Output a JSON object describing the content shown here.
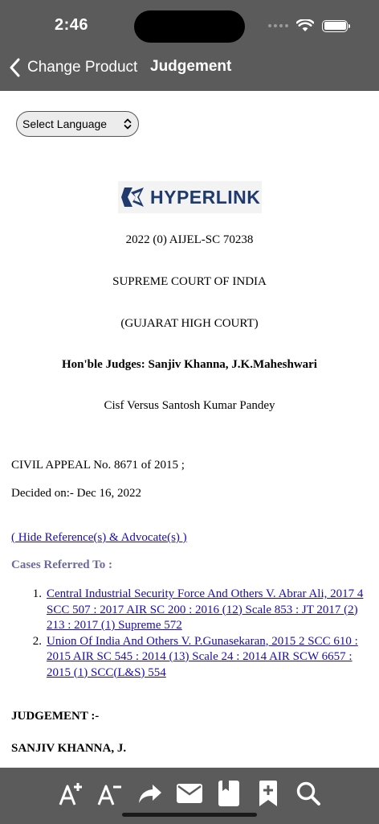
{
  "status_bar": {
    "time": "2:46"
  },
  "nav": {
    "back_label": "Change Product",
    "title": "Judgement"
  },
  "language_select": {
    "label": "Select Language"
  },
  "logo": {
    "text": "HYPERLINK"
  },
  "document": {
    "citation": "2022 (0) AIJEL-SC 70238",
    "court": "SUPREME COURT OF INDIA",
    "lower_court": "(GUJARAT HIGH COURT)",
    "judges": "Hon'ble Judges: Sanjiv Khanna, J.K.Maheshwari",
    "parties": "Cisf Versus Santosh Kumar Pandey",
    "appeal": "CIVIL APPEAL No. 8671 of 2015 ;",
    "decided": "Decided on:- Dec 16, 2022",
    "hide_refs_link": "( Hide Reference(s) & Advocate(s) )",
    "cases_heading": "Cases Referred To :",
    "cases": [
      {
        "num": "1.",
        "text": "Central Industrial Security Force And Others V. Abrar Ali, 2017 4 SCC 507 : 2017 AIR SC 200 : 2016 (12) Scale 853 : JT 2017 (2) 213 : 2017 (1) Supreme 572"
      },
      {
        "num": "2.",
        "text": "Union Of India And Others V. P.Gunasekaran, 2015 2 SCC 610 : 2015 AIR SC 545 : 2014 (13) Scale 24 : 2014 AIR SCW 6657 : 2015 (1) SCC(L&S) 554"
      }
    ],
    "judgement_heading": "JUDGEMENT :-",
    "author": "SANJIV KHANNA, J."
  },
  "toolbar": {
    "icons": [
      "font-increase-icon",
      "font-decrease-icon",
      "share-icon",
      "mail-icon",
      "book-icon",
      "bookmark-add-icon",
      "search-icon"
    ]
  }
}
